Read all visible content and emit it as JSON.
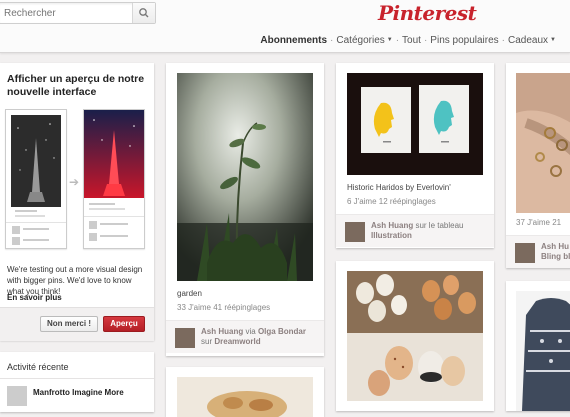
{
  "search": {
    "placeholder": "Rechercher"
  },
  "logo": "Pinterest",
  "nav": {
    "abonnements": "Abonnements",
    "categories": "Catégories",
    "tout": "Tout",
    "pins_populaires": "Pins populaires",
    "cadeaux": "Cadeaux"
  },
  "promo": {
    "title": "Afficher un aperçu de notre nouvelle interface",
    "text": "We're testing out a more visual design with bigger pins. We'd love to know what you think!",
    "link": "En savoir plus",
    "no_button": "Non merci !",
    "yes_button": "Aperçu"
  },
  "activity": {
    "title": "Activité récente",
    "item": "Manfrotto Imagine More"
  },
  "pins": [
    {
      "caption": "garden",
      "stats": "33 J'aime   41 réépinglages",
      "user": "Ash Huang",
      "via_label": "via",
      "via_user": "Olga Bondar",
      "board_prefix": "sur",
      "board": "Dreamworld"
    },
    {
      "caption": "Historic Haridos by Everlovin'",
      "stats": "6 J'aime   12 réépinglages",
      "user": "Ash Huang",
      "board_prefix": "sur le tableau",
      "board": "Illustration"
    },
    {
      "stats": "37 J'aime   21",
      "user": "Ash Hu",
      "board": "Bling bl"
    }
  ]
}
